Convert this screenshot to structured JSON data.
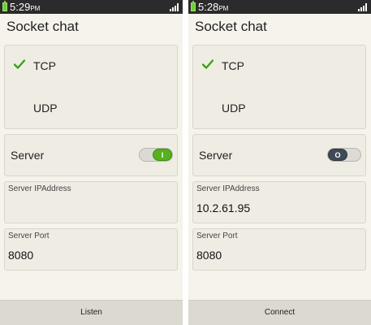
{
  "screens": [
    {
      "status_bar": {
        "time": "5:29",
        "ampm": "PM"
      },
      "title": "Socket chat",
      "protocols": [
        {
          "label": "TCP",
          "selected": true
        },
        {
          "label": "UDP",
          "selected": false
        }
      ],
      "server": {
        "label": "Server",
        "toggle_on": true,
        "toggle_symbol": "I"
      },
      "ip_field": {
        "label": "Server IPAddress",
        "value": ""
      },
      "port_field": {
        "label": "Server Port",
        "value": "8080"
      },
      "action_button": "Listen"
    },
    {
      "status_bar": {
        "time": "5:28",
        "ampm": "PM"
      },
      "title": "Socket chat",
      "protocols": [
        {
          "label": "TCP",
          "selected": true
        },
        {
          "label": "UDP",
          "selected": false
        }
      ],
      "server": {
        "label": "Server",
        "toggle_on": false,
        "toggle_symbol": "O"
      },
      "ip_field": {
        "label": "Server IPAddress",
        "value": "10.2.61.95"
      },
      "port_field": {
        "label": "Server Port",
        "value": "8080"
      },
      "action_button": "Connect"
    }
  ],
  "colors": {
    "check": "#3aa21a",
    "toggle_on": "#55b21d",
    "toggle_off": "#3f4a57",
    "background": "#f6f3ec"
  },
  "icons": {
    "check": "check-icon",
    "battery": "battery-icon",
    "signal": "signal-icon"
  }
}
